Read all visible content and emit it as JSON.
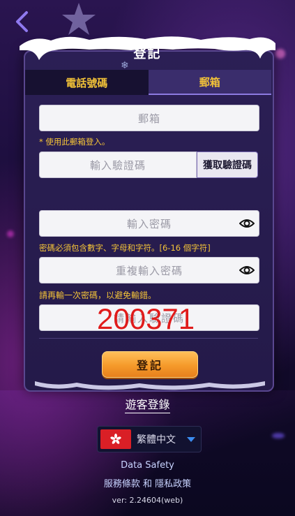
{
  "header": {
    "title": "登記"
  },
  "tabs": [
    {
      "label": "電話號碼",
      "active": false
    },
    {
      "label": "郵箱",
      "active": true
    }
  ],
  "form": {
    "email": {
      "placeholder": "郵箱",
      "hint": "* 使用此郵箱登入。"
    },
    "verification": {
      "placeholder": "輸入驗證碼",
      "button_label": "獲取驗證碼"
    },
    "password": {
      "placeholder": "輸入密碼",
      "hint": "密碼必須包含數字、字母和字符。[6-16 個字符]"
    },
    "confirm_password": {
      "placeholder": "重複輸入密碼",
      "hint": "請再輸一次密碼，以避免輸錯。"
    },
    "captcha": {
      "placeholder": "請輸入驗證碼",
      "code": "200371"
    },
    "submit_label": "登記"
  },
  "guest_login_label": "遊客登錄",
  "language": {
    "selected": "繁體中文",
    "flag": "hong-kong-flag"
  },
  "footer": {
    "data_safety": "Data Safety",
    "terms": "服務條款 和 隱私政策",
    "version": "ver: 2.24604(web)"
  },
  "colors": {
    "accent_yellow": "#f3c338",
    "button_orange": "#f59a2a",
    "captcha_red": "#e01b1b",
    "panel": "#2b1f55"
  }
}
